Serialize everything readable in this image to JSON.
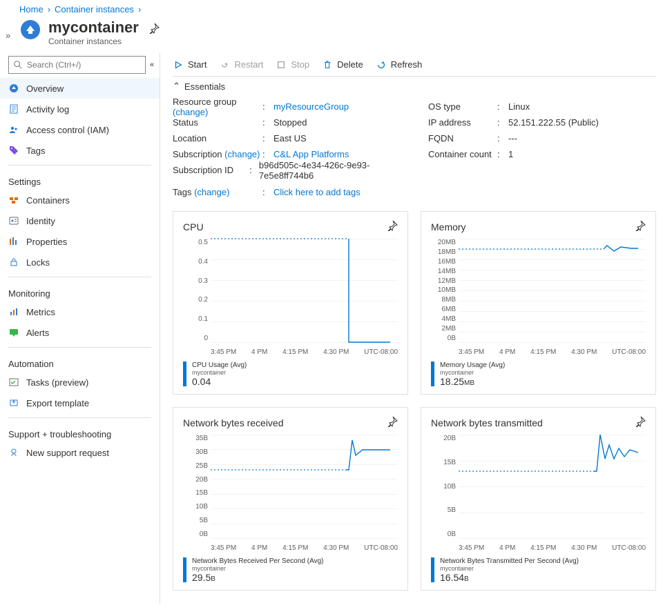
{
  "breadcrumbs": {
    "home": "Home",
    "ci": "Container instances"
  },
  "title": "mycontainer",
  "subtitle": "Container instances",
  "search": {
    "placeholder": "Search (Ctrl+/)"
  },
  "nav": {
    "overview": "Overview",
    "activitylog": "Activity log",
    "iam": "Access control (IAM)",
    "tags": "Tags",
    "group_settings": "Settings",
    "containers": "Containers",
    "identity": "Identity",
    "properties": "Properties",
    "locks": "Locks",
    "group_monitoring": "Monitoring",
    "metrics": "Metrics",
    "alerts": "Alerts",
    "group_automation": "Automation",
    "tasks": "Tasks (preview)",
    "export": "Export template",
    "group_support": "Support + troubleshooting",
    "support": "New support request"
  },
  "commands": {
    "start": "Start",
    "restart": "Restart",
    "stop": "Stop",
    "delete": "Delete",
    "refresh": "Refresh"
  },
  "essentials": {
    "header": "Essentials",
    "left": {
      "rg_label": "Resource group",
      "rg_change": "(change)",
      "rg_value": "myResourceGroup",
      "status_label": "Status",
      "status_value": "Stopped",
      "location_label": "Location",
      "location_value": "East US",
      "sub_label": "Subscription",
      "sub_change": "(change)",
      "sub_value": "C&L App Platforms",
      "subid_label": "Subscription ID",
      "subid_value": "b96d505c-4e34-426c-9e93-7e5e8ff744b6"
    },
    "right": {
      "os_label": "OS type",
      "os_value": "Linux",
      "ip_label": "IP address",
      "ip_value": "52.151.222.55 (Public)",
      "fqdn_label": "FQDN",
      "fqdn_value": "---",
      "count_label": "Container count",
      "count_value": "1"
    },
    "tags_label": "Tags",
    "tags_change": "(change)",
    "tags_value": "Click here to add tags"
  },
  "charts": {
    "x_ticks": [
      "3:45 PM",
      "4 PM",
      "4:15 PM",
      "4:30 PM",
      "UTC-08:00"
    ],
    "cpu": {
      "title": "CPU",
      "metric": "CPU Usage (Avg)",
      "resource": "mycontainer",
      "value": "0.04",
      "y_ticks": [
        "0.5",
        "0.4",
        "0.3",
        "0.2",
        "0.1",
        "0"
      ]
    },
    "mem": {
      "title": "Memory",
      "metric": "Memory Usage (Avg)",
      "resource": "mycontainer",
      "value": "18.25",
      "unit": "MB",
      "y_ticks": [
        "20MB",
        "18MB",
        "16MB",
        "14MB",
        "12MB",
        "10MB",
        "8MB",
        "6MB",
        "4MB",
        "2MB",
        "0B"
      ]
    },
    "netrx": {
      "title": "Network bytes received",
      "metric": "Network Bytes Received Per Second (Avg)",
      "resource": "mycontainer",
      "value": "29.5",
      "unit": "B",
      "y_ticks": [
        "35B",
        "30B",
        "25B",
        "20B",
        "15B",
        "10B",
        "5B",
        "0B"
      ]
    },
    "nettx": {
      "title": "Network bytes transmitted",
      "metric": "Network Bytes Transmitted Per Second (Avg)",
      "resource": "mycontainer",
      "value": "16.54",
      "unit": "B",
      "y_ticks": [
        "20B",
        "15B",
        "10B",
        "5B",
        "0B"
      ]
    }
  },
  "chart_data": [
    {
      "type": "line",
      "title": "CPU",
      "ylabel": "CPU Usage (Avg)",
      "ylim": [
        0,
        0.5
      ],
      "x": [
        "3:45 PM",
        "4 PM",
        "4:15 PM",
        "4:30 PM"
      ],
      "series": [
        {
          "name": "mycontainer (avg, dotted)",
          "values": [
            0.5,
            0.5,
            0.5,
            0.5
          ]
        },
        {
          "name": "mycontainer (current)",
          "values": [
            0.5,
            0.5,
            0.5,
            0.0
          ]
        }
      ],
      "summary": 0.04
    },
    {
      "type": "line",
      "title": "Memory",
      "ylabel": "Memory Usage (Avg) MB",
      "ylim": [
        0,
        20
      ],
      "x": [
        "3:45 PM",
        "4 PM",
        "4:15 PM",
        "4:30 PM"
      ],
      "series": [
        {
          "name": "mycontainer (avg, dotted)",
          "values": [
            18,
            18,
            18,
            18
          ]
        },
        {
          "name": "mycontainer (current)",
          "values": [
            null,
            null,
            null,
            18
          ]
        }
      ],
      "summary": 18.25,
      "unit": "MB"
    },
    {
      "type": "line",
      "title": "Network bytes received",
      "ylabel": "Bytes/s",
      "ylim": [
        0,
        35
      ],
      "x": [
        "3:45 PM",
        "4 PM",
        "4:15 PM",
        "4:30 PM"
      ],
      "series": [
        {
          "name": "mycontainer (avg, dotted)",
          "values": [
            23,
            23,
            23,
            23
          ]
        },
        {
          "name": "mycontainer (current)",
          "values": [
            null,
            null,
            null,
            30
          ]
        }
      ],
      "summary": 29.5,
      "unit": "B"
    },
    {
      "type": "line",
      "title": "Network bytes transmitted",
      "ylabel": "Bytes/s",
      "ylim": [
        0,
        20
      ],
      "x": [
        "3:45 PM",
        "4 PM",
        "4:15 PM",
        "4:30 PM"
      ],
      "series": [
        {
          "name": "mycontainer (avg, dotted)",
          "values": [
            13,
            13,
            13,
            13
          ]
        },
        {
          "name": "mycontainer (current)",
          "values": [
            null,
            null,
            null,
            17
          ]
        }
      ],
      "summary": 16.54,
      "unit": "B"
    }
  ]
}
